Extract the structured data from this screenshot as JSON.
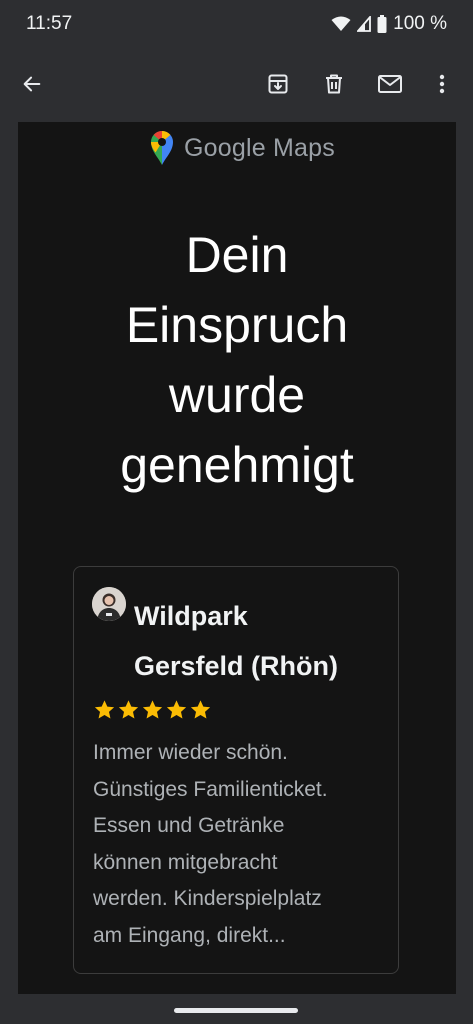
{
  "status_bar": {
    "time": "11:57",
    "battery": "100 %",
    "icons": [
      "wifi-icon",
      "signal-icon",
      "battery-icon"
    ]
  },
  "app_bar": {
    "icons": [
      "back-arrow-icon",
      "archive-icon",
      "delete-icon",
      "mark-unread-icon",
      "more-vert-icon"
    ]
  },
  "email": {
    "logo_text": "Google Maps",
    "headline_lines": [
      "Dein",
      "Einspruch",
      "wurde",
      "genehmigt"
    ],
    "review": {
      "place_lines": [
        "Wildpark",
        "Gersfeld (Rhön)"
      ],
      "rating": 5,
      "text_lines": [
        "Immer wieder schön.",
        "Günstiges Familienticket.",
        "Essen und Getränke",
        "können mitgebracht",
        "werden. Kinderspielplatz",
        "am Eingang, direkt..."
      ]
    }
  },
  "colors": {
    "background": "#2d2e31",
    "email_background": "#141414",
    "star": "#fbbc04",
    "text_primary": "#ffffff",
    "text_secondary": "#aeb2b6"
  }
}
